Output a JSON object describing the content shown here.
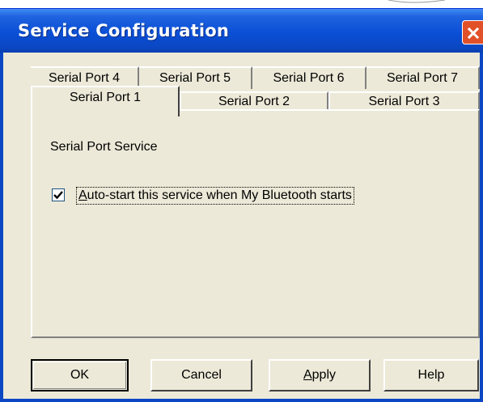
{
  "window": {
    "title": "Service Configuration",
    "close_icon": "close-icon"
  },
  "tabs": {
    "back_row": [
      {
        "label": "Serial Port 4"
      },
      {
        "label": "Serial Port 5"
      },
      {
        "label": "Serial Port 6"
      },
      {
        "label": "Serial Port 7"
      }
    ],
    "front_row": [
      {
        "label": "Serial Port 1",
        "selected": true
      },
      {
        "label": "Serial Port 2",
        "selected": false
      },
      {
        "label": "Serial Port 3",
        "selected": false
      }
    ]
  },
  "panel": {
    "service_label": "Serial Port Service",
    "autostart": {
      "label": "Auto-start this service when My Bluetooth starts",
      "checked": true
    }
  },
  "buttons": {
    "ok": "OK",
    "cancel": "Cancel",
    "apply": "Apply",
    "help": "Help"
  },
  "colors": {
    "titlebar": "#0a4fd6",
    "close_button": "#e2502a",
    "dialog_face": "#ece9d8"
  }
}
